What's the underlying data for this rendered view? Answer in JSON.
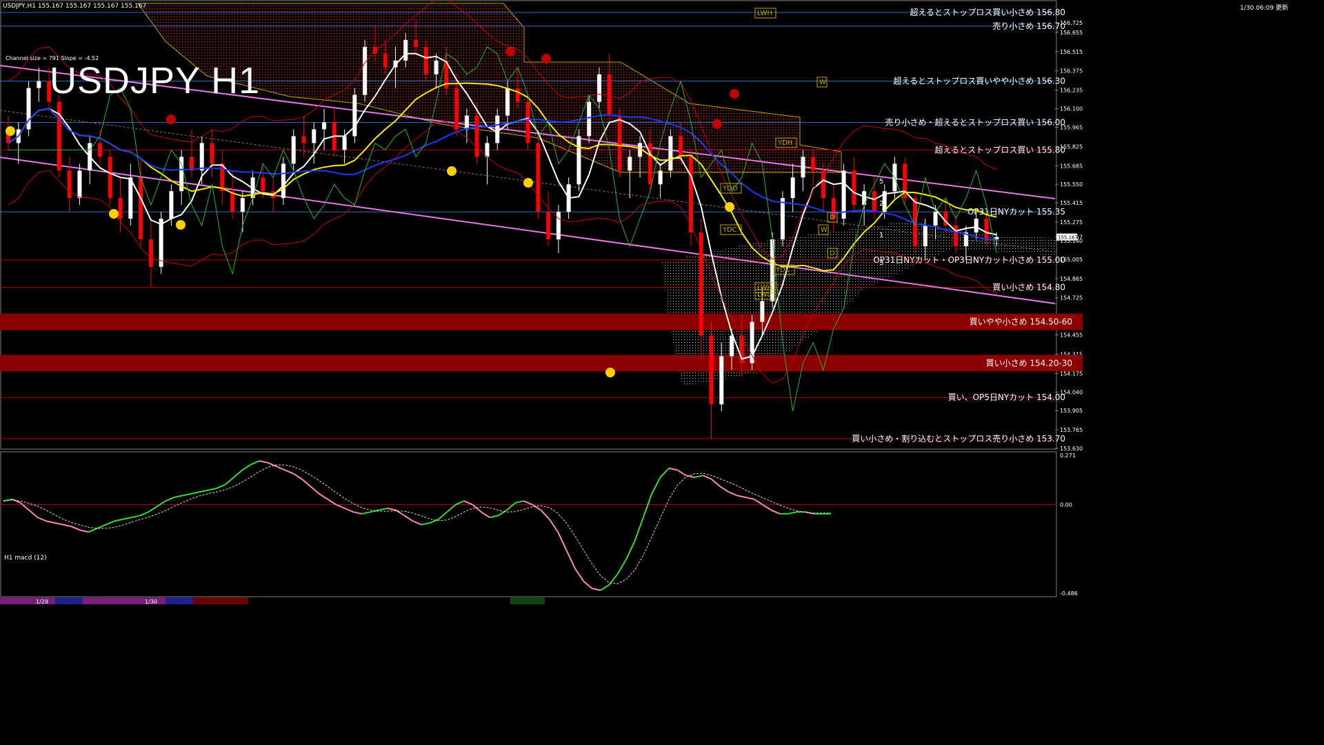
{
  "header": {
    "symbol_info": "USDJPY,H1  155.167 155.167 155.167 155.167",
    "timestamp": "1/30 06:09 更新",
    "channel_info": "Channel size = 791 Slope = -4.52",
    "title": "USDJPY H1",
    "macd_title": "H1  macd (12)"
  },
  "colors": {
    "candle_up": "#ffffff",
    "candle_down": "#ff0000",
    "cloud": "#ff2020",
    "level_line": "#2e6fbf",
    "red_line": "#c00000",
    "band_fill": "#8b0000",
    "macd_up": "#33dd33",
    "macd_down": "#ff88bb",
    "channel_line": "#e878e8"
  },
  "chart_data": {
    "type": "candlestick",
    "symbol": "USDJPY",
    "timeframe": "H1",
    "last_price": 155.167,
    "ylim": [
      153.63,
      156.85
    ],
    "y_ticks": [
      "156.725",
      "156.655",
      "156.515",
      "156.375",
      "156.235",
      "156.100",
      "155.965",
      "155.825",
      "155.685",
      "155.550",
      "155.415",
      "155.275",
      "155.167",
      "155.140",
      "155.005",
      "154.865",
      "154.725",
      "154.590",
      "154.455",
      "154.315",
      "154.175",
      "154.040",
      "153.905",
      "153.765",
      "153.630"
    ],
    "x_labels": [
      "1/29",
      "1/30"
    ],
    "levels": [
      {
        "price": 156.8,
        "label": "超えるとストップロス買い小さめ 156.80",
        "kind": "blue"
      },
      {
        "price": 156.7,
        "label": "売り小さめ 156.70",
        "kind": "blue"
      },
      {
        "price": 156.3,
        "label": "超えるとストップロス買いやや小さめ 156.30",
        "kind": "blue"
      },
      {
        "price": 156.0,
        "label": "売り小さめ・超えるとストップロス買い 156.00",
        "kind": "blue"
      },
      {
        "price": 155.8,
        "label": "超えるとストップロス買い 155.80",
        "kind": "red"
      },
      {
        "price": 155.35,
        "label": "OP31日NYカット 155.35",
        "kind": "blue"
      },
      {
        "price": 155.0,
        "label": "OP31日NYカット・OP3日NYカット小さめ 155.00",
        "kind": "red"
      },
      {
        "price": 154.8,
        "label": "買い小さめ 154.80",
        "kind": "red"
      },
      {
        "price": 154.55,
        "label": "買いやや小さめ 154.50-60",
        "kind": "band"
      },
      {
        "price": 154.25,
        "label": "買い小さめ 154.20-30",
        "kind": "band"
      },
      {
        "price": 154.0,
        "label": "買い、OP5日NYカット 154.00",
        "kind": "red"
      },
      {
        "price": 153.7,
        "label": "買い小さめ・割り込むとストップロス売り小さめ 153.70",
        "kind": "red"
      }
    ],
    "small_labels": [
      "LWH",
      "LWH",
      "W",
      "YDH",
      "YDO",
      "YDC",
      "YDL",
      "LWL",
      "W",
      "D",
      "D",
      "5",
      "2",
      "1",
      "3"
    ],
    "candles": [
      [
        155.95,
        156.05,
        155.8,
        155.85
      ],
      [
        155.85,
        156.0,
        155.7,
        155.95
      ],
      [
        155.95,
        156.3,
        155.9,
        156.25
      ],
      [
        156.25,
        156.4,
        156.15,
        156.3
      ],
      [
        156.3,
        156.4,
        156.1,
        156.15
      ],
      [
        156.15,
        156.2,
        155.6,
        155.65
      ],
      [
        155.65,
        155.75,
        155.35,
        155.45
      ],
      [
        155.45,
        155.7,
        155.4,
        155.65
      ],
      [
        155.65,
        155.9,
        155.55,
        155.85
      ],
      [
        155.85,
        155.95,
        155.7,
        155.75
      ],
      [
        155.75,
        155.8,
        155.4,
        155.45
      ],
      [
        155.45,
        155.6,
        155.2,
        155.3
      ],
      [
        155.3,
        155.7,
        155.25,
        155.6
      ],
      [
        155.6,
        155.75,
        155.1,
        155.15
      ],
      [
        155.15,
        155.3,
        154.8,
        154.95
      ],
      [
        154.95,
        155.35,
        154.9,
        155.3
      ],
      [
        155.3,
        155.55,
        155.25,
        155.5
      ],
      [
        155.5,
        155.8,
        155.4,
        155.75
      ],
      [
        155.75,
        155.95,
        155.6,
        155.65
      ],
      [
        155.65,
        155.9,
        155.55,
        155.85
      ],
      [
        155.85,
        155.95,
        155.6,
        155.7
      ],
      [
        155.7,
        155.8,
        155.4,
        155.5
      ],
      [
        155.5,
        155.65,
        155.3,
        155.35
      ],
      [
        155.35,
        155.5,
        155.2,
        155.45
      ],
      [
        155.45,
        155.65,
        155.4,
        155.6
      ],
      [
        155.6,
        155.7,
        155.45,
        155.5
      ],
      [
        155.5,
        155.6,
        155.35,
        155.45
      ],
      [
        155.45,
        155.75,
        155.4,
        155.7
      ],
      [
        155.7,
        155.95,
        155.65,
        155.9
      ],
      [
        155.9,
        156.05,
        155.75,
        155.85
      ],
      [
        155.85,
        156.0,
        155.7,
        155.95
      ],
      [
        155.95,
        156.1,
        155.8,
        156.0
      ],
      [
        156.0,
        156.1,
        155.75,
        155.8
      ],
      [
        155.8,
        155.95,
        155.7,
        155.9
      ],
      [
        155.9,
        156.25,
        155.85,
        156.2
      ],
      [
        156.2,
        156.6,
        156.15,
        156.55
      ],
      [
        156.55,
        156.7,
        156.45,
        156.5
      ],
      [
        156.5,
        156.6,
        156.35,
        156.4
      ],
      [
        156.4,
        156.55,
        156.25,
        156.45
      ],
      [
        156.45,
        156.65,
        156.4,
        156.6
      ],
      [
        156.6,
        156.75,
        156.5,
        156.55
      ],
      [
        156.55,
        156.6,
        156.3,
        156.35
      ],
      [
        156.35,
        156.5,
        156.25,
        156.45
      ],
      [
        156.45,
        156.55,
        156.2,
        156.25
      ],
      [
        156.25,
        156.35,
        155.9,
        155.95
      ],
      [
        155.95,
        156.1,
        155.85,
        156.05
      ],
      [
        156.05,
        156.15,
        155.7,
        155.75
      ],
      [
        155.75,
        155.9,
        155.55,
        155.85
      ],
      [
        155.85,
        156.1,
        155.8,
        156.05
      ],
      [
        156.05,
        156.3,
        155.95,
        156.25
      ],
      [
        156.25,
        156.4,
        156.1,
        156.15
      ],
      [
        156.15,
        156.2,
        155.8,
        155.85
      ],
      [
        155.85,
        155.95,
        155.3,
        155.35
      ],
      [
        155.35,
        155.5,
        155.1,
        155.15
      ],
      [
        155.15,
        155.4,
        155.05,
        155.35
      ],
      [
        155.35,
        155.6,
        155.3,
        155.55
      ],
      [
        155.55,
        155.95,
        155.5,
        155.9
      ],
      [
        155.9,
        156.2,
        155.85,
        156.15
      ],
      [
        156.15,
        156.4,
        156.1,
        156.35
      ],
      [
        156.35,
        156.5,
        156.0,
        156.05
      ],
      [
        156.05,
        156.1,
        155.6,
        155.65
      ],
      [
        155.65,
        155.8,
        155.45,
        155.75
      ],
      [
        155.75,
        155.9,
        155.6,
        155.85
      ],
      [
        155.85,
        155.95,
        155.5,
        155.55
      ],
      [
        155.55,
        155.7,
        155.45,
        155.65
      ],
      [
        155.65,
        155.95,
        155.6,
        155.9
      ],
      [
        155.9,
        156.0,
        155.7,
        155.75
      ],
      [
        155.75,
        155.8,
        155.1,
        155.2
      ],
      [
        155.2,
        155.3,
        154.3,
        154.45
      ],
      [
        154.45,
        154.55,
        153.7,
        153.95
      ],
      [
        153.95,
        154.4,
        153.9,
        154.3
      ],
      [
        154.3,
        154.5,
        154.2,
        154.45
      ],
      [
        154.45,
        154.6,
        154.15,
        154.25
      ],
      [
        154.25,
        154.6,
        154.2,
        154.55
      ],
      [
        154.55,
        154.8,
        154.45,
        154.7
      ],
      [
        154.7,
        155.2,
        154.65,
        155.15
      ],
      [
        155.15,
        155.5,
        155.1,
        155.45
      ],
      [
        155.45,
        155.7,
        155.35,
        155.6
      ],
      [
        155.6,
        155.8,
        155.5,
        155.75
      ],
      [
        155.75,
        155.8,
        155.55,
        155.65
      ],
      [
        155.65,
        155.7,
        155.35,
        155.45
      ],
      [
        155.45,
        155.55,
        155.2,
        155.3
      ],
      [
        155.3,
        155.7,
        155.25,
        155.65
      ],
      [
        155.65,
        155.75,
        155.35,
        155.4
      ],
      [
        155.4,
        155.55,
        155.25,
        155.5
      ],
      [
        155.5,
        155.6,
        155.3,
        155.35
      ],
      [
        155.35,
        155.55,
        155.3,
        155.5
      ],
      [
        155.5,
        155.75,
        155.45,
        155.7
      ],
      [
        155.7,
        155.75,
        155.4,
        155.45
      ],
      [
        155.45,
        155.5,
        155.05,
        155.1
      ],
      [
        155.1,
        155.3,
        155.0,
        155.25
      ],
      [
        155.25,
        155.4,
        155.15,
        155.35
      ],
      [
        155.35,
        155.45,
        155.2,
        155.25
      ],
      [
        155.25,
        155.35,
        155.05,
        155.1
      ],
      [
        155.1,
        155.25,
        155.0,
        155.2
      ],
      [
        155.2,
        155.35,
        155.15,
        155.3
      ],
      [
        155.3,
        155.35,
        155.1,
        155.15
      ],
      [
        155.15,
        155.2,
        155.1,
        155.167
      ]
    ],
    "macd": [
      0.02,
      0.03,
      0.01,
      -0.03,
      -0.07,
      -0.09,
      -0.1,
      -0.11,
      -0.12,
      -0.14,
      -0.15,
      -0.13,
      -0.11,
      -0.09,
      -0.08,
      -0.07,
      -0.06,
      -0.04,
      -0.01,
      0.02,
      0.04,
      0.05,
      0.06,
      0.07,
      0.08,
      0.09,
      0.11,
      0.15,
      0.19,
      0.22,
      0.24,
      0.23,
      0.21,
      0.19,
      0.17,
      0.14,
      0.1,
      0.06,
      0.03,
      0.0,
      -0.02,
      -0.04,
      -0.05,
      -0.04,
      -0.03,
      -0.02,
      -0.03,
      -0.06,
      -0.09,
      -0.11,
      -0.1,
      -0.08,
      -0.04,
      0.0,
      0.02,
      0.0,
      -0.04,
      -0.07,
      -0.06,
      -0.03,
      0.01,
      0.02,
      0.0,
      -0.03,
      -0.08,
      -0.15,
      -0.25,
      -0.35,
      -0.42,
      -0.46,
      -0.47,
      -0.44,
      -0.38,
      -0.3,
      -0.2,
      -0.07,
      0.06,
      0.15,
      0.2,
      0.19,
      0.16,
      0.15,
      0.16,
      0.14,
      0.1,
      0.07,
      0.05,
      0.04,
      0.03,
      0.0,
      -0.03,
      -0.05,
      -0.05,
      -0.04,
      -0.04,
      -0.05,
      -0.05,
      -0.05
    ],
    "macd_ylim": [
      -0.486,
      0.271
    ],
    "macd_ticks": [
      "0.271",
      "0.00",
      "-0.486"
    ]
  }
}
